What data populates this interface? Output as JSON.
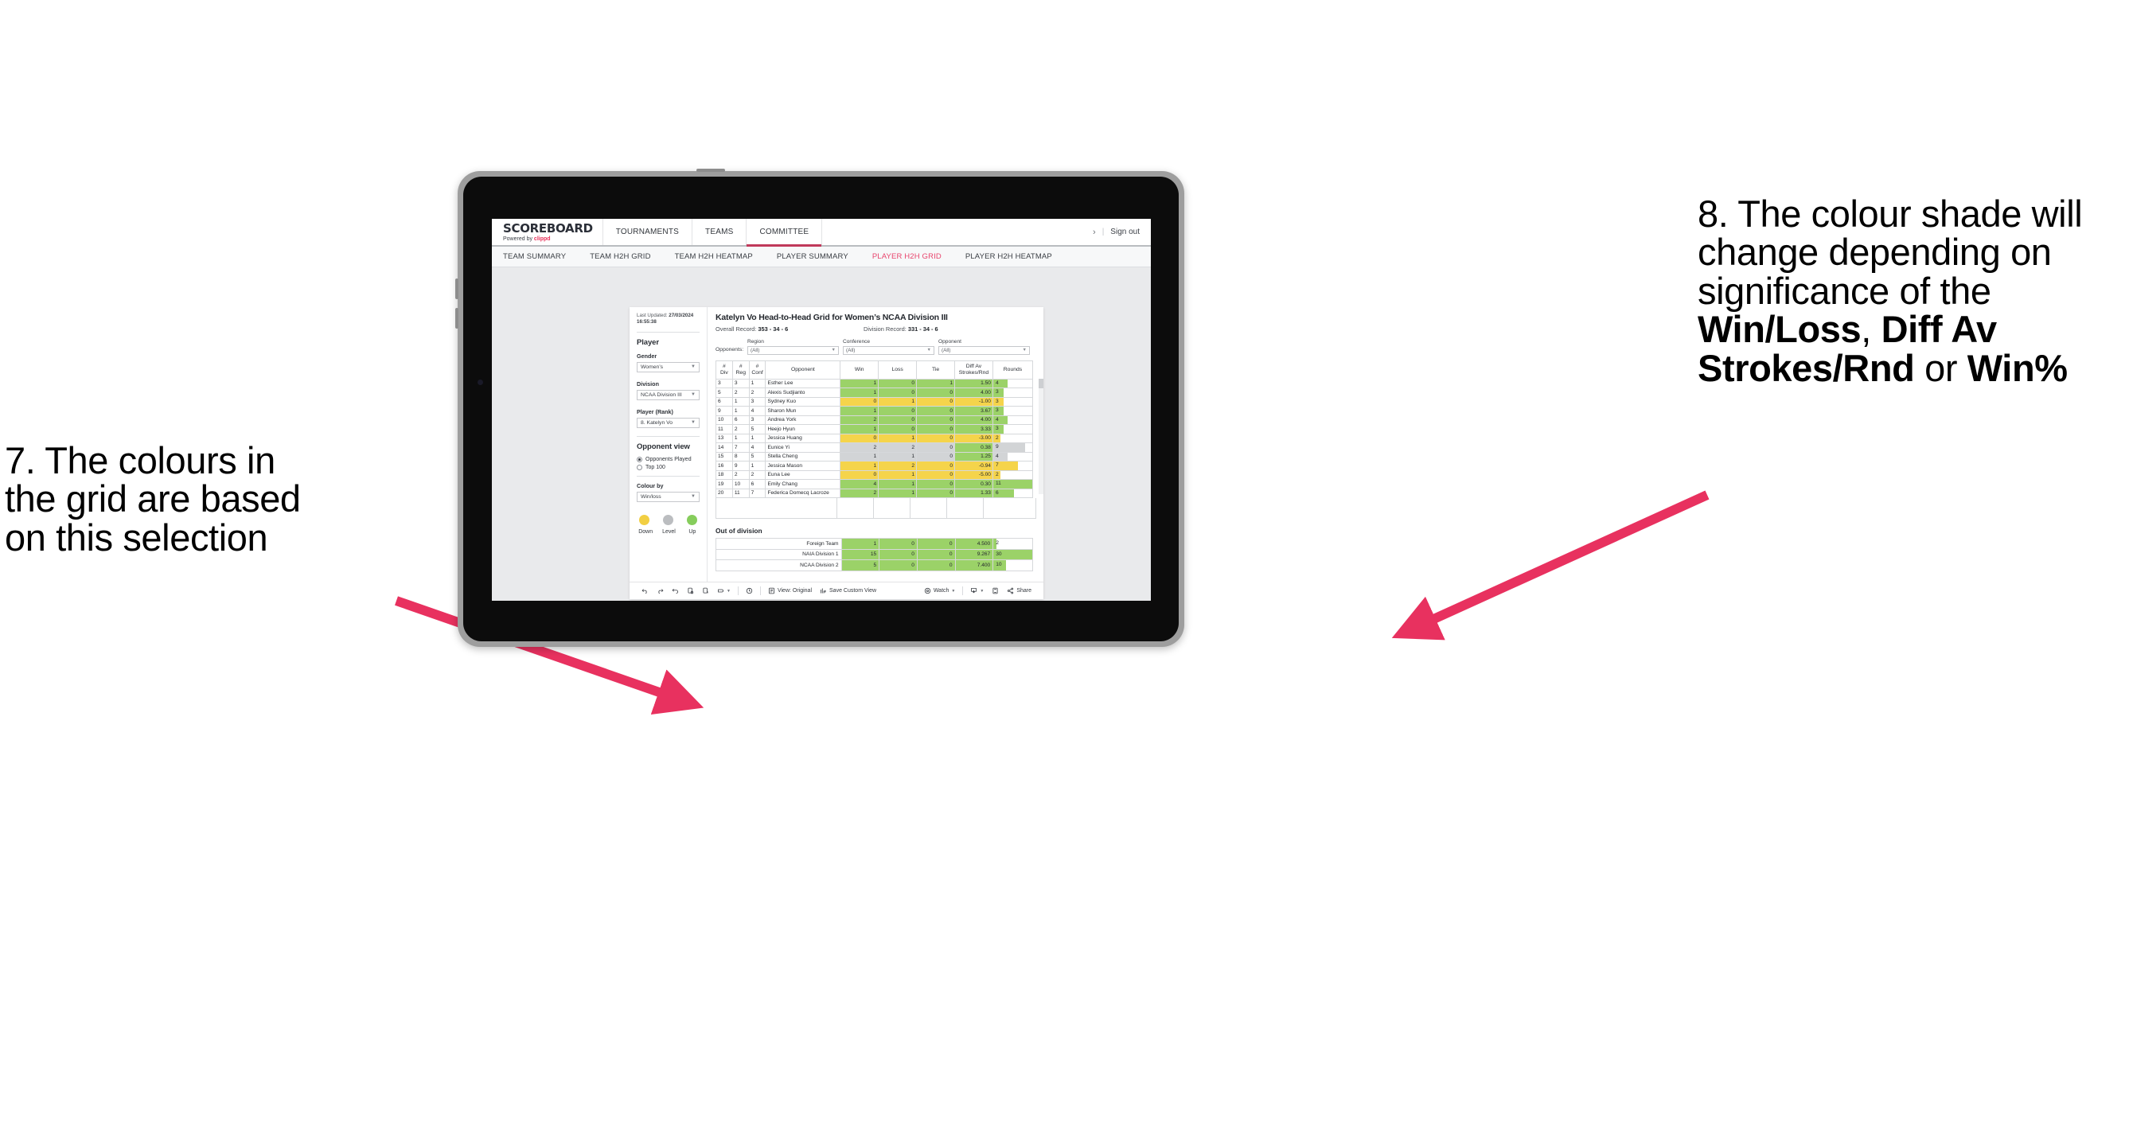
{
  "annotations": {
    "left": {
      "id": "annotation-7",
      "lines": [
        "7. The colours in",
        "the grid are based",
        "on this selection"
      ]
    },
    "right": {
      "id": "annotation-8",
      "pre": "8. The colour shade will change depending on significance of the ",
      "bold1": "Win/Loss",
      "mid1": ", ",
      "bold2": "Diff Av Strokes/Rnd",
      "mid2": " or ",
      "bold3": "Win%"
    },
    "arrow_color": "#e8315f"
  },
  "app": {
    "brand": {
      "title": "SCOREBOARD",
      "powered_prefix": "Powered by ",
      "powered_brand": "clippd"
    },
    "topnav": [
      {
        "label": "TOURNAMENTS",
        "active": false
      },
      {
        "label": "TEAMS",
        "active": false
      },
      {
        "label": "COMMITTEE",
        "active": true
      }
    ],
    "header_right": {
      "chevron": "›",
      "divider": "|",
      "sign_out": "Sign out"
    },
    "subnav": [
      {
        "label": "TEAM SUMMARY",
        "active": false
      },
      {
        "label": "TEAM H2H GRID",
        "active": false
      },
      {
        "label": "TEAM H2H HEATMAP",
        "active": false
      },
      {
        "label": "PLAYER SUMMARY",
        "active": false
      },
      {
        "label": "PLAYER H2H GRID",
        "active": true
      },
      {
        "label": "PLAYER H2H HEATMAP",
        "active": false
      }
    ],
    "accent_pink": "#e8456d"
  },
  "filters": {
    "last_updated_label": "Last Updated: ",
    "last_updated_value": "27/03/2024 16:55:38",
    "player_heading": "Player",
    "gender": {
      "label": "Gender",
      "value": "Women’s"
    },
    "division": {
      "label": "Division",
      "value": "NCAA Division III"
    },
    "player_rank": {
      "label": "Player (Rank)",
      "value": "8. Katelyn Vo"
    },
    "opponent_view": {
      "heading": "Opponent view",
      "options": [
        {
          "label": "Opponents Played",
          "selected": true
        },
        {
          "label": "Top 100",
          "selected": false
        }
      ]
    },
    "colour_by": {
      "label": "Colour by",
      "value": "Win/loss"
    },
    "legend": [
      {
        "label": "Down",
        "color": "#f2cf43"
      },
      {
        "label": "Level",
        "color": "#bbbdc0"
      },
      {
        "label": "Up",
        "color": "#86cd5c"
      }
    ]
  },
  "viz": {
    "title": "Katelyn Vo Head-to-Head Grid for Women’s NCAA Division III",
    "overall_record_label": "Overall Record: ",
    "overall_record_value": "353 -  34 - 6",
    "division_record_label": "Division Record: ",
    "division_record_value": "331 -  34 - 6",
    "opponents_label": "Opponents:",
    "opponent_filters": [
      {
        "label": "Region",
        "value": "(All)"
      },
      {
        "label": "Conference",
        "value": "(All)"
      },
      {
        "label": "Opponent",
        "value": "(All)"
      }
    ],
    "columns": [
      {
        "l1": "#",
        "l2": "Div"
      },
      {
        "l1": "#",
        "l2": "Reg"
      },
      {
        "l1": "#",
        "l2": "Conf"
      },
      {
        "l1": "Opponent",
        "l2": ""
      },
      {
        "l1": "Win",
        "l2": ""
      },
      {
        "l1": "Loss",
        "l2": ""
      },
      {
        "l1": "Tie",
        "l2": ""
      },
      {
        "l1": "Diff Av",
        "l2": "Strokes/Rnd"
      },
      {
        "l1": "Rounds",
        "l2": ""
      }
    ],
    "rows": [
      {
        "div": "3",
        "reg": "3",
        "conf": "1",
        "opponent": "Esther Lee",
        "win": "1",
        "loss": "0",
        "tie": "1",
        "diff": "1.50",
        "rounds": "4",
        "shade": "g",
        "bar_pct": 36
      },
      {
        "div": "5",
        "reg": "2",
        "conf": "2",
        "opponent": "Alexis Sudjianto",
        "win": "1",
        "loss": "0",
        "tie": "0",
        "diff": "4.00",
        "rounds": "3",
        "shade": "g",
        "bar_pct": 27
      },
      {
        "div": "6",
        "reg": "1",
        "conf": "3",
        "opponent": "Sydney Kuo",
        "win": "0",
        "loss": "1",
        "tie": "0",
        "diff": "-1.00",
        "rounds": "3",
        "shade": "y",
        "bar_pct": 27
      },
      {
        "div": "9",
        "reg": "1",
        "conf": "4",
        "opponent": "Sharon Mun",
        "win": "1",
        "loss": "0",
        "tie": "0",
        "diff": "3.67",
        "rounds": "3",
        "shade": "g",
        "bar_pct": 27
      },
      {
        "div": "10",
        "reg": "6",
        "conf": "3",
        "opponent": "Andrea York",
        "win": "2",
        "loss": "0",
        "tie": "0",
        "diff": "4.00",
        "rounds": "4",
        "shade": "g",
        "bar_pct": 36
      },
      {
        "div": "11",
        "reg": "2",
        "conf": "5",
        "opponent": "Heejo Hyun",
        "win": "1",
        "loss": "0",
        "tie": "0",
        "diff": "3.33",
        "rounds": "3",
        "shade": "g",
        "bar_pct": 27
      },
      {
        "div": "13",
        "reg": "1",
        "conf": "1",
        "opponent": "Jessica Huang",
        "win": "0",
        "loss": "1",
        "tie": "0",
        "diff": "-3.00",
        "rounds": "2",
        "shade": "y",
        "bar_pct": 18
      },
      {
        "div": "14",
        "reg": "7",
        "conf": "4",
        "opponent": "Eunice Yi",
        "win": "2",
        "loss": "2",
        "tie": "0",
        "diff": "0.38",
        "rounds": "9",
        "shade": "n",
        "diff_shade": "g",
        "bar_pct": 81
      },
      {
        "div": "15",
        "reg": "8",
        "conf": "5",
        "opponent": "Stella Cheng",
        "win": "1",
        "loss": "1",
        "tie": "0",
        "diff": "1.25",
        "rounds": "4",
        "shade": "n",
        "diff_shade": "g",
        "bar_pct": 36
      },
      {
        "div": "16",
        "reg": "9",
        "conf": "1",
        "opponent": "Jessica Mason",
        "win": "1",
        "loss": "2",
        "tie": "0",
        "diff": "-0.94",
        "rounds": "7",
        "shade": "y",
        "bar_pct": 63
      },
      {
        "div": "18",
        "reg": "2",
        "conf": "2",
        "opponent": "Euna Lee",
        "win": "0",
        "loss": "1",
        "tie": "0",
        "diff": "-5.00",
        "rounds": "2",
        "shade": "y",
        "bar_pct": 18
      },
      {
        "div": "19",
        "reg": "10",
        "conf": "6",
        "opponent": "Emily Chang",
        "win": "4",
        "loss": "1",
        "tie": "0",
        "diff": "0.30",
        "rounds": "11",
        "shade": "g",
        "bar_pct": 100
      },
      {
        "div": "20",
        "reg": "11",
        "conf": "7",
        "opponent": "Federica Domecq Lacroze",
        "win": "2",
        "loss": "1",
        "tie": "0",
        "diff": "1.33",
        "rounds": "6",
        "shade": "g",
        "bar_pct": 54
      }
    ],
    "out_of_division": {
      "title": "Out of division",
      "rows": [
        {
          "name": "Foreign Team",
          "win": "1",
          "loss": "0",
          "tie": "0",
          "diff": "4.500",
          "rounds": "2",
          "shade": "g",
          "bar_pct": 7
        },
        {
          "name": "NAIA Division 1",
          "win": "15",
          "loss": "0",
          "tie": "0",
          "diff": "9.267",
          "rounds": "30",
          "shade": "g",
          "bar_pct": 100
        },
        {
          "name": "NCAA Division 2",
          "win": "5",
          "loss": "0",
          "tie": "0",
          "diff": "7.400",
          "rounds": "10",
          "shade": "g",
          "bar_pct": 33
        }
      ]
    },
    "colors": {
      "green": "#9bd268",
      "yellow": "#f5d44b",
      "neutral": "#d2d4d6"
    }
  },
  "toolbar": {
    "items": [
      {
        "name": "undo-icon",
        "label": ""
      },
      {
        "name": "redo-icon",
        "label": ""
      },
      {
        "name": "revert-icon",
        "label": ""
      },
      {
        "name": "refresh-data-icon",
        "label": ""
      },
      {
        "name": "pause-updates-icon",
        "label": ""
      },
      {
        "name": "highlight-icon",
        "label": "",
        "caret": true
      },
      {
        "name": "history-icon",
        "label": ""
      },
      {
        "name": "view-original-icon",
        "label": "View: Original"
      },
      {
        "name": "save-custom-view-icon",
        "label": "Save Custom View"
      },
      {
        "name": "watch-icon",
        "label": "Watch",
        "caret": true
      },
      {
        "name": "download-icon",
        "label": "",
        "caret": true
      },
      {
        "name": "fullscreen-icon",
        "label": ""
      },
      {
        "name": "share-icon",
        "label": "Share"
      }
    ]
  }
}
